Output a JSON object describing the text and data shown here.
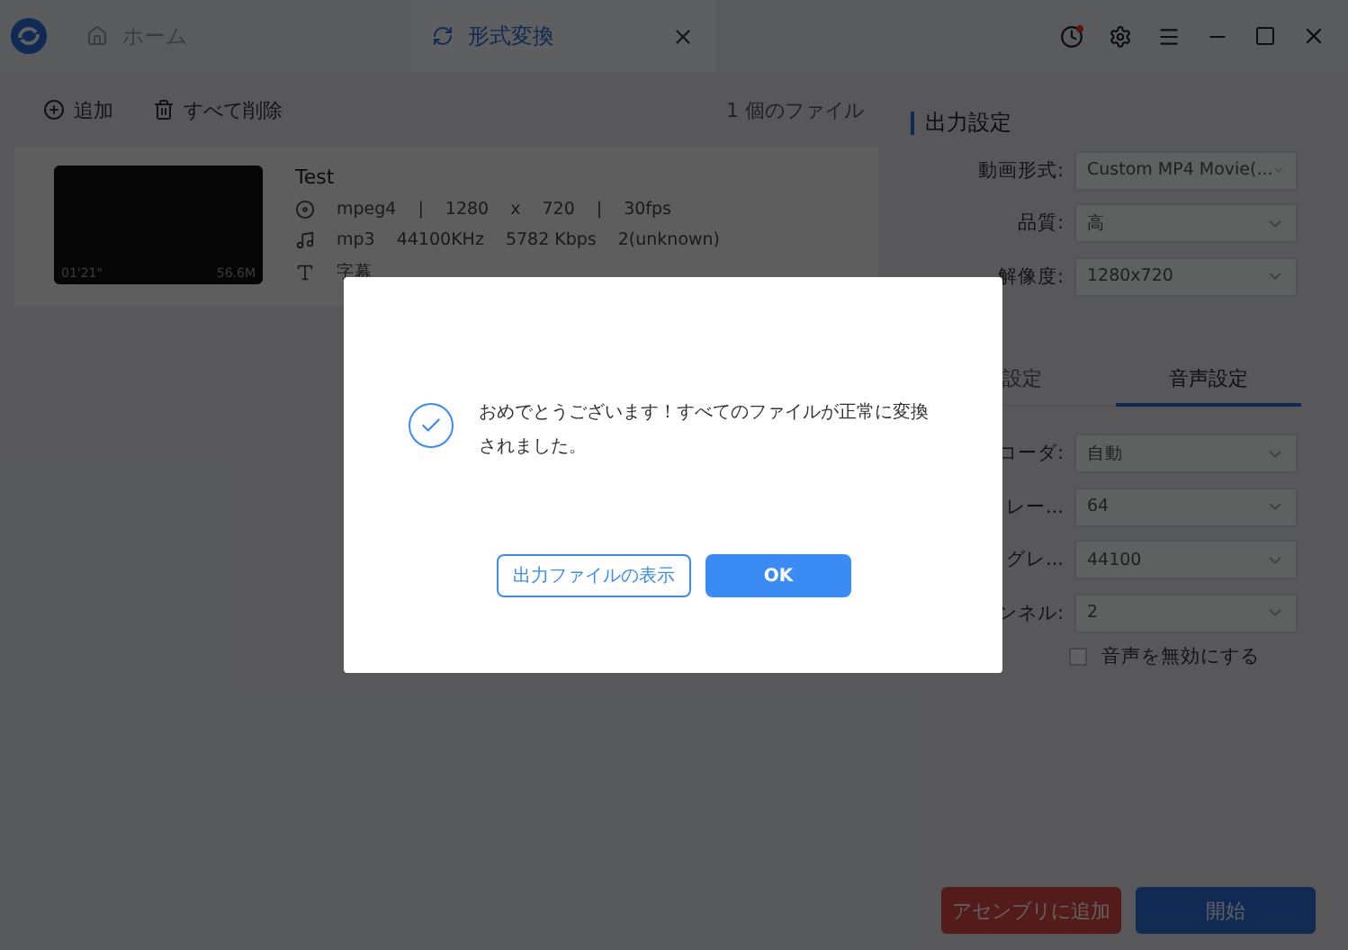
{
  "tabs": [
    {
      "label": "ホーム",
      "selected": false
    },
    {
      "label": "形式変換",
      "selected": true
    }
  ],
  "toolbar": {
    "add": "追加",
    "clear": "すべて削除",
    "file_count": "1 個のファイル"
  },
  "files": [
    {
      "name": "Test",
      "duration": "01'21\"",
      "size": "56.6M",
      "video": [
        "mpeg4",
        "|",
        "1280",
        "x",
        "720",
        "|",
        "30fps"
      ],
      "audio": [
        "mp3",
        "44100KHz",
        "5782 Kbps",
        "2(unknown)"
      ],
      "subtitle": "字幕"
    }
  ],
  "output_settings": {
    "title": "出力設定",
    "fields": [
      {
        "label": "動画形式:",
        "value": "Custom MP4 Movie(..."
      },
      {
        "label": "品質:",
        "value": "高"
      },
      {
        "label": "解像度:",
        "value": "1280x720"
      }
    ],
    "tabs": [
      {
        "label": "設定",
        "selected": false
      },
      {
        "label": "音声設定",
        "selected": true
      }
    ],
    "audio_fields": [
      {
        "label": "コーダ:",
        "value": "自動"
      },
      {
        "label": "レー...",
        "value": "64"
      },
      {
        "label": "グレ...",
        "value": "44100"
      },
      {
        "label": "ンネル:",
        "value": "2"
      }
    ],
    "mute": {
      "label": "音声を無効にする",
      "checked": false
    }
  },
  "footer_buttons": [
    {
      "label": "アセンブリに追加",
      "kind": "assembly"
    },
    {
      "label": "開始",
      "kind": "start"
    }
  ],
  "dialog": {
    "message": "おめでとうございます！すべてのファイルが正常に変換されました。",
    "buttons": [
      {
        "label": "出力ファイルの表示",
        "kind": "secondary"
      },
      {
        "label": "OK",
        "kind": "primary"
      }
    ]
  }
}
